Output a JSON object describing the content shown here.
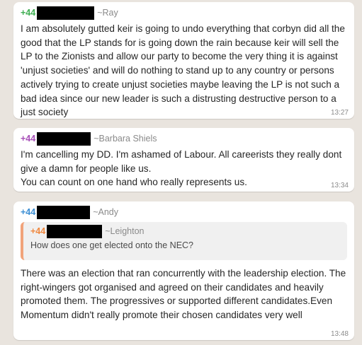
{
  "colors": {
    "phone_green": "#3fae52",
    "phone_purple": "#a74fb8",
    "phone_blue": "#3b8ed3",
    "phone_orange": "#f0883f",
    "quote_bar": "#f1a37a",
    "background": "#e9e4de",
    "bubble": "#ffffff"
  },
  "messages": [
    {
      "phone": "+44",
      "sender": "~Ray",
      "text": "I am absolutely gutted keir is going to undo everything that corbyn did all the good that the LP stands for is going down the rain because keir will sell the LP to the Zionists and allow our party to become the very thing it is against 'unjust societies' and will do nothing to stand up to any country or persons actively trying to create unjust societies maybe leaving the LP is not such a bad idea since our new leader is such a distrusting destructive person to a just society",
      "time": "13:27"
    },
    {
      "phone": "+44",
      "sender": "~Barbara Shiels",
      "text": "I'm cancelling my DD. I'm ashamed of Labour. All careerists they really dont give a damn for people like us.\nYou can count on one hand who really represents us.",
      "time": "13:34"
    },
    {
      "phone": "+44",
      "sender": "~Andy",
      "quote": {
        "phone": "+44",
        "sender": "~Leighton",
        "text": "How does one get elected onto the NEC?"
      },
      "text": "There was an election that ran concurrently with the leadership election. The right-wingers got organised and agreed on their candidates and heavily promoted them. The progressives or supported different candidates.Even Momentum didn't really promote their chosen candidates very well",
      "time": "13:48"
    }
  ]
}
